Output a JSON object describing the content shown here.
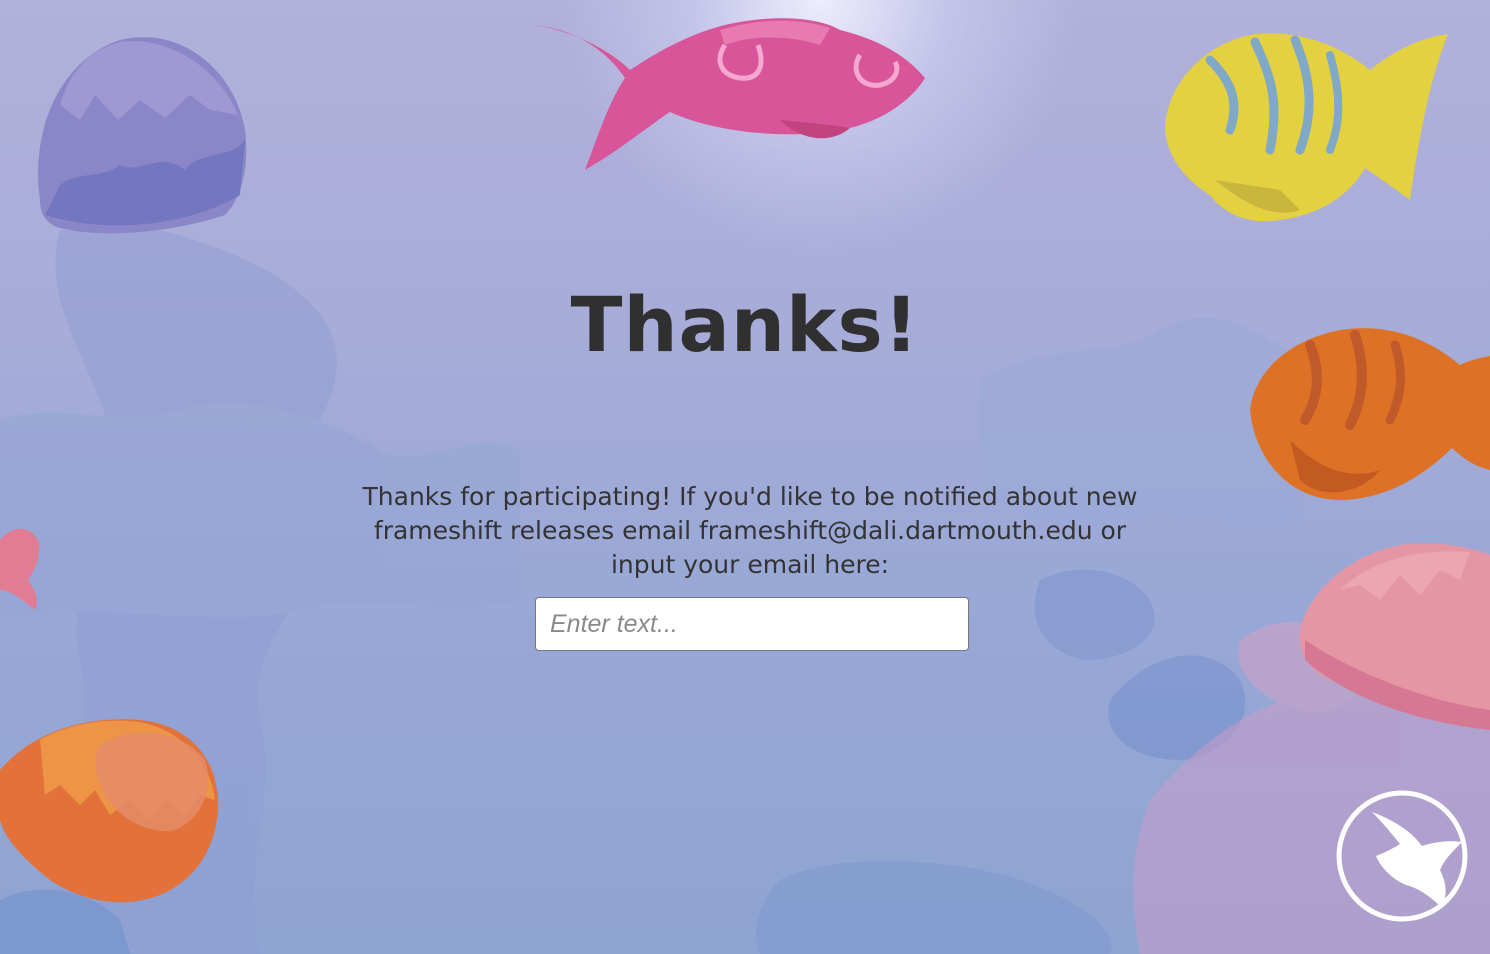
{
  "screen": {
    "title": "Thanks!",
    "message": "Thanks for participating!  If you'd like to be notified about new\nframeshift releases email frameshift@dali.dartmouth.edu or\ninput your email here:"
  },
  "email_input": {
    "value": "",
    "placeholder": "Enter text..."
  },
  "next_button": {
    "icon": "fish-arrow-icon"
  },
  "colors": {
    "title": "#303030",
    "text": "#333333",
    "pink_fish": "#d8559a",
    "yellow_fish": "#e3d142",
    "orange_fish": "#dd7226",
    "purple_jellyfish": "#8a86c8",
    "orange_jellyfish": "#e3713a",
    "pink_jellyfish": "#e596a4"
  }
}
